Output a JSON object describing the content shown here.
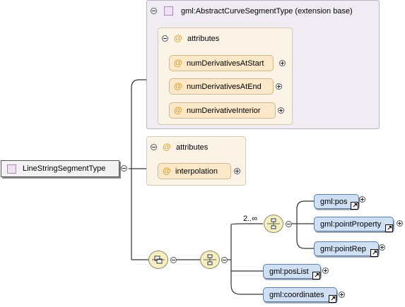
{
  "root": {
    "name": "LineStringSegmentType"
  },
  "extension": {
    "title": "gml:AbstractCurveSegmentType (extension base)",
    "attributes_label": "attributes",
    "attributes": [
      "numDerivativesAtStart",
      "numDerivativesAtEnd",
      "numDerivativeInterior"
    ]
  },
  "own_attributes": {
    "label": "attributes",
    "items": [
      "interpolation"
    ]
  },
  "content": {
    "choice_cardinality": "2..∞",
    "choice_elements": [
      "gml:pos",
      "gml:pointProperty",
      "gml:pointRep"
    ],
    "other_elements": [
      "gml:posList",
      "gml:coordinates"
    ]
  },
  "colors": {
    "extension_bg": "#efecf3",
    "attribute_bg": "#fbe8c8",
    "element_bg": "#cfe0f5",
    "compositor_bg": "#f5eec0"
  },
  "icons": {
    "type": "type-icon",
    "attribute": "at-sign-icon",
    "collapse": "minus-circle-icon",
    "expand": "plus-circle-icon",
    "reference": "reference-arrow-icon",
    "sequence": "sequence-compositor-icon",
    "choice": "choice-compositor-icon"
  }
}
